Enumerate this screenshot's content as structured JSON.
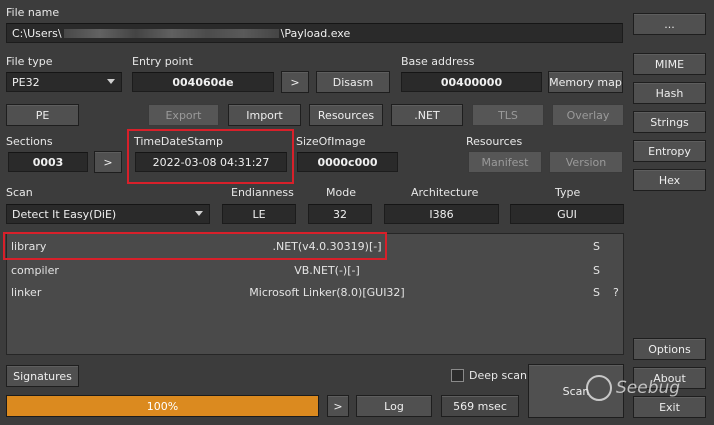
{
  "file_name": {
    "label": "File name",
    "path_prefix": "C:\\Users\\",
    "path_suffix": "\\Payload.exe",
    "browse_label": "..."
  },
  "file_type": {
    "label": "File type",
    "value": "PE32"
  },
  "entry_point": {
    "label": "Entry point",
    "value": "004060de",
    "go_label": ">",
    "disasm_label": "Disasm"
  },
  "base_address": {
    "label": "Base address",
    "value": "00400000",
    "memory_map_label": "Memory map"
  },
  "toolbar": {
    "pe": "PE",
    "export": "Export",
    "import": "Import",
    "resources": "Resources",
    "dotnet": ".NET",
    "tls": "TLS",
    "overlay": "Overlay"
  },
  "sections": {
    "label": "Sections",
    "value": "0003",
    "go_label": ">"
  },
  "timestamp": {
    "label": "TimeDateStamp",
    "value": "2022-03-08 04:31:27"
  },
  "size_of_image": {
    "label": "SizeOfImage",
    "value": "0000c000"
  },
  "resources_group": {
    "label": "Resources",
    "manifest": "Manifest",
    "version": "Version"
  },
  "scan": {
    "label": "Scan",
    "engine": "Detect It Easy(DiE)"
  },
  "endianness": {
    "label": "Endianness",
    "value": "LE"
  },
  "mode": {
    "label": "Mode",
    "value": "32"
  },
  "architecture": {
    "label": "Architecture",
    "value": "I386"
  },
  "type": {
    "label": "Type",
    "value": "GUI"
  },
  "results": [
    {
      "kind": "library",
      "name": ".NET(v4.0.30319)[-]",
      "flag": "S",
      "extra": ""
    },
    {
      "kind": "compiler",
      "name": "VB.NET(-)[-]",
      "flag": "S",
      "extra": ""
    },
    {
      "kind": "linker",
      "name": "Microsoft Linker(8.0)[GUI32]",
      "flag": "S",
      "extra": "?"
    }
  ],
  "side_buttons": {
    "mime": "MIME",
    "hash": "Hash",
    "strings": "Strings",
    "entropy": "Entropy",
    "hex": "Hex",
    "options": "Options",
    "about": "About",
    "exit": "Exit"
  },
  "bottom": {
    "signatures": "Signatures",
    "deep_scan": "Deep scan",
    "scan_button": "Scan",
    "progress_text": "100%",
    "progress_percent": 100,
    "go_label": ">",
    "log": "Log",
    "elapsed": "569 msec"
  },
  "watermark": "Seebug",
  "colors": {
    "highlight": "#d8202a",
    "progress": "#db8a1f"
  }
}
